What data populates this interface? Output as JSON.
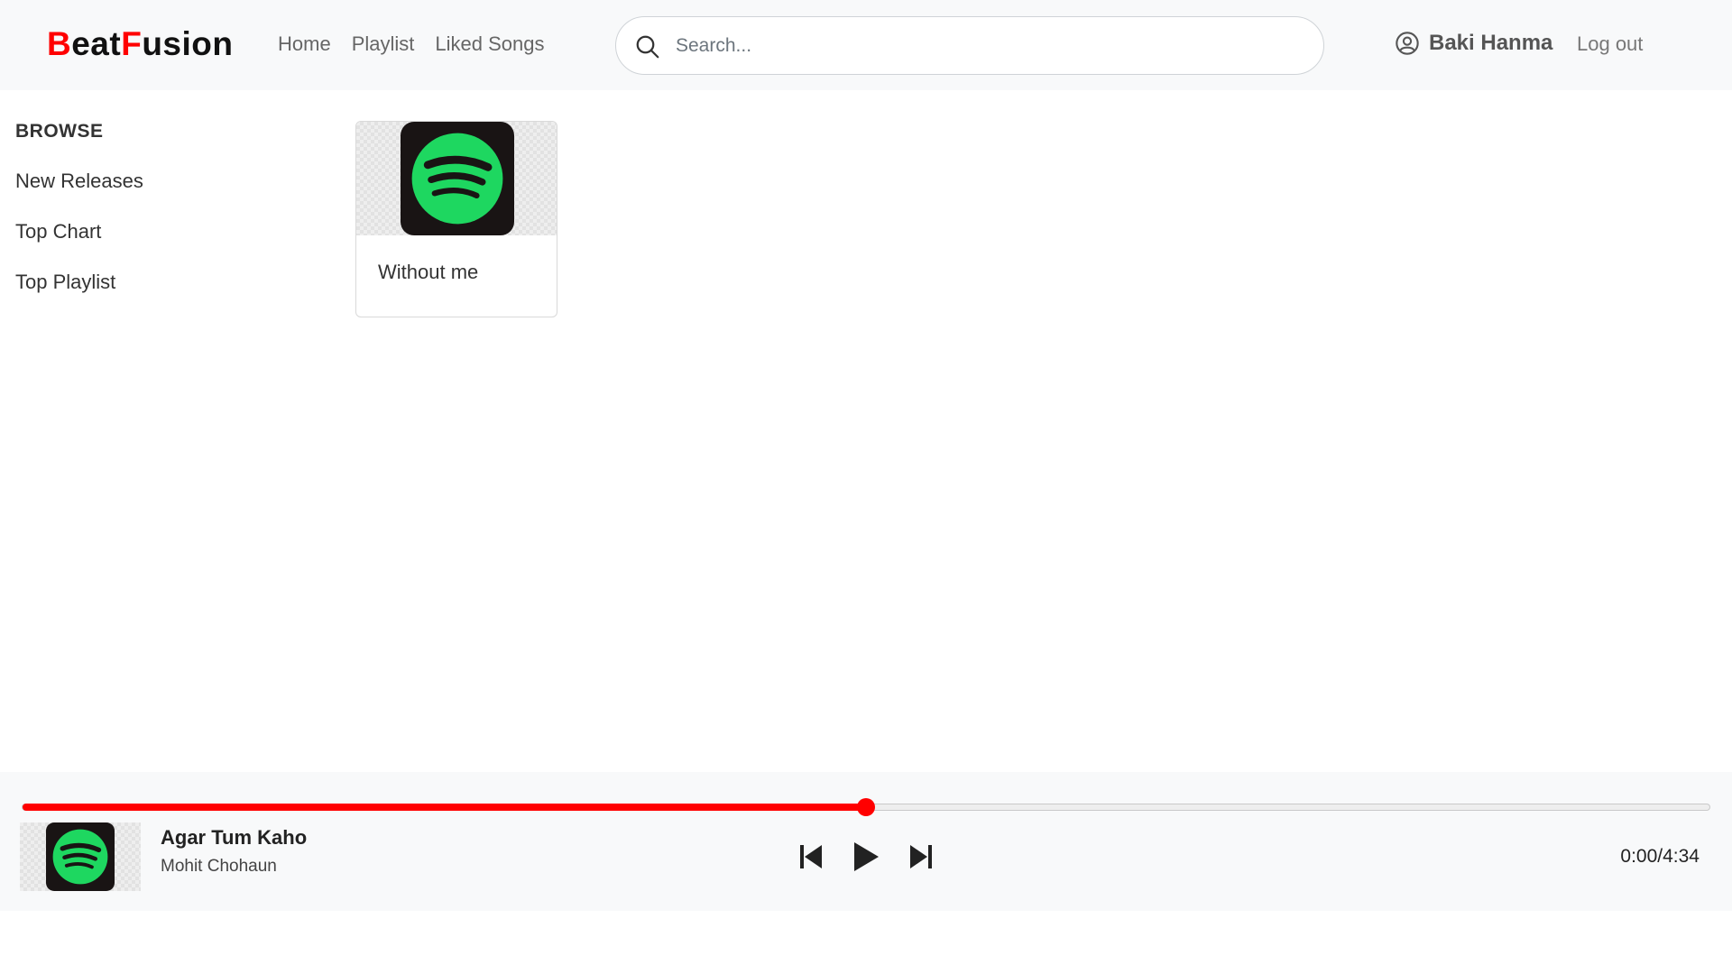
{
  "app": {
    "brand_first_letter": "B",
    "brand_part1": "eat",
    "brand_second_letter": "F",
    "brand_part2": "usion",
    "brand_accent_color": "#ff0000"
  },
  "nav": {
    "links": [
      "Home",
      "Playlist",
      "Liked Songs"
    ]
  },
  "search": {
    "placeholder": "Search...",
    "value": "",
    "icon": "search-icon"
  },
  "user": {
    "name": "Baki Hanma",
    "icon": "user-circle-icon",
    "logout_label": "Log out"
  },
  "sidebar": {
    "heading": "BROWSE",
    "items": [
      "New Releases",
      "Top Chart",
      "Top Playlist"
    ]
  },
  "songs": [
    {
      "title": "Without me",
      "art_icon": "spotify-logo-icon"
    }
  ],
  "player": {
    "track_title": "Agar Tum Kaho",
    "track_artist": "Mohit Chohaun",
    "art_icon": "spotify-logo-icon",
    "progress_fraction": 0.5,
    "time_display": "0:00/4:34",
    "progress_color": "#ff0000",
    "controls": [
      "skip-previous-icon",
      "play-icon",
      "skip-next-icon"
    ]
  }
}
